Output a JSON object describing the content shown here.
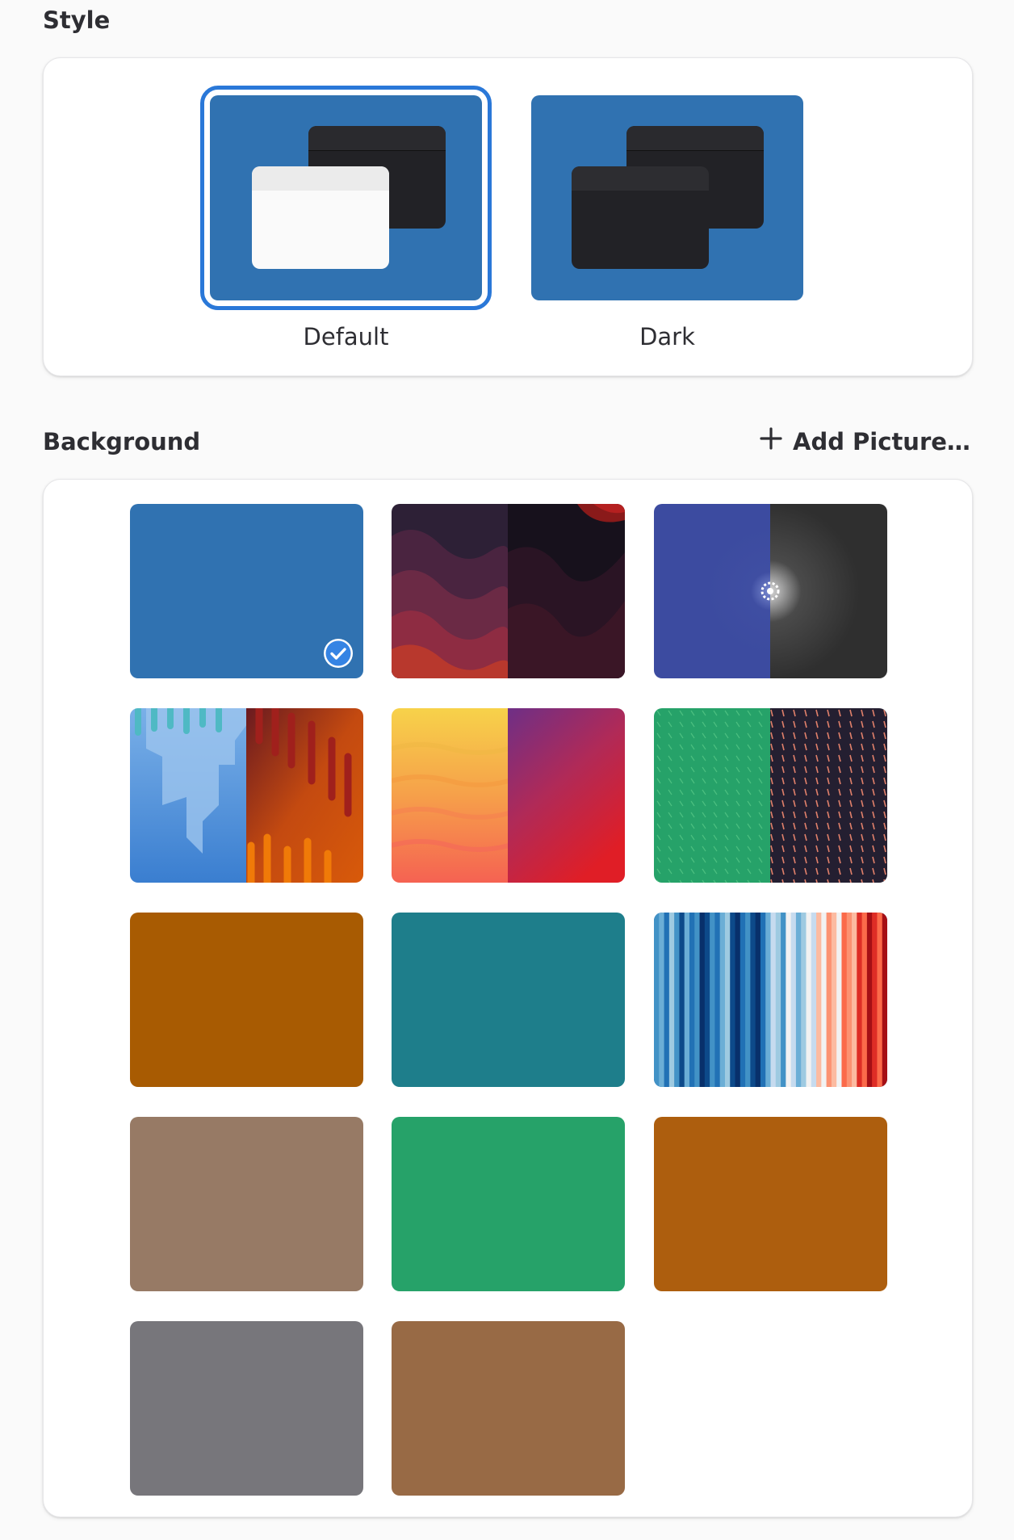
{
  "style": {
    "title": "Style",
    "options": [
      {
        "label": "Default",
        "selected": true
      },
      {
        "label": "Dark",
        "selected": false
      }
    ]
  },
  "background": {
    "title": "Background",
    "add_label": "Add Picture…",
    "selected_index": 0,
    "tiles": [
      {
        "name": "blue",
        "color": "#3072b1"
      },
      {
        "name": "waves-red",
        "color": "#7a1f3a"
      },
      {
        "name": "gnome-logo",
        "color": "#3c4ba0"
      },
      {
        "name": "drips",
        "color": "#c44a10"
      },
      {
        "name": "amber-waves",
        "color": "#f6a04a"
      },
      {
        "name": "fields",
        "color": "#26a269"
      },
      {
        "name": "orange",
        "color": "#a85b02"
      },
      {
        "name": "teal",
        "color": "#1e7e8b"
      },
      {
        "name": "stripes",
        "color": "#1a5aa0"
      },
      {
        "name": "taupe",
        "color": "#977a65"
      },
      {
        "name": "green",
        "color": "#26a269"
      },
      {
        "name": "bronze",
        "color": "#ad5e0e"
      },
      {
        "name": "slate",
        "color": "#77767b"
      },
      {
        "name": "brown",
        "color": "#986a45"
      }
    ]
  }
}
